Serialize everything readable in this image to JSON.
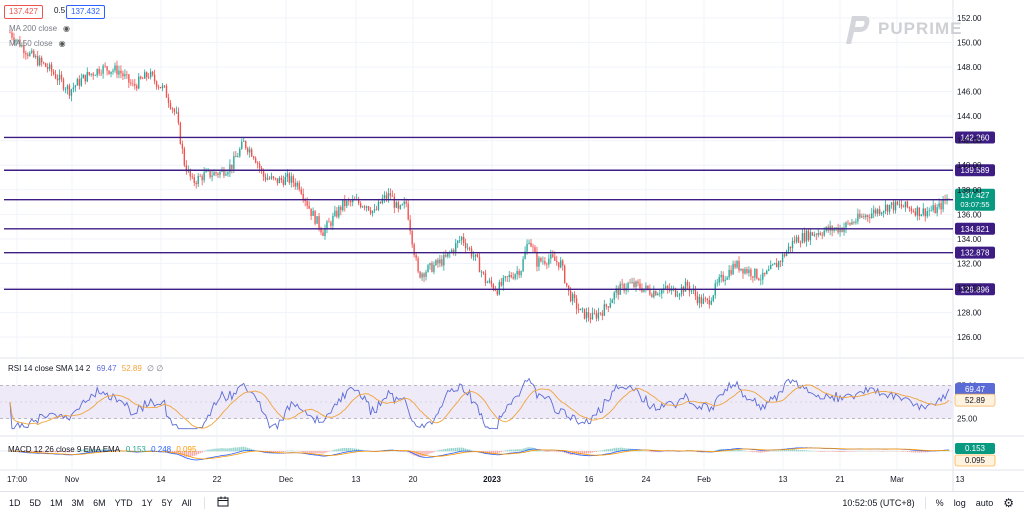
{
  "header": {
    "bid": "137.427",
    "spread": "0.5",
    "ask": "137.432"
  },
  "legend": {
    "ma200": "MA 200 close",
    "ma50": "MA 50 close",
    "rsi": "RSI 14 close SMA 14 2",
    "rsi_val": "69.47",
    "rsi_sma_val": "52.89",
    "rsi_extra": "∅ ∅",
    "macd": "MACD 12 26 close 9 EMA EMA",
    "macd_val": "0.153",
    "macd_signal": "0.248",
    "macd_hist": "0.095"
  },
  "logo": {
    "text": "PUPRIME"
  },
  "colors": {
    "bull": "#26a69a",
    "bear": "#ef5350",
    "level": "#3d1d84",
    "rsi": "#5b6bd6",
    "rsi_ma": "#f0a33a",
    "macd": "#2962ff",
    "signal": "#ff9800",
    "current": "#089981"
  },
  "chart_data": {
    "type": "candlestick",
    "y_ticks": [
      126,
      128,
      130,
      132,
      134,
      136,
      138,
      140,
      142,
      144,
      146,
      148,
      150,
      152
    ],
    "ylim": [
      124.3,
      152.8
    ],
    "x_ticks": [
      "17:00",
      "Nov",
      "14",
      "22",
      "Dec",
      "13",
      "20",
      "2023",
      "16",
      "24",
      "Feb",
      "13",
      "21",
      "Mar",
      "13"
    ],
    "price_path": [
      [
        0,
        150.8
      ],
      [
        10,
        149.0
      ],
      [
        20,
        147.8
      ],
      [
        30,
        146.1
      ],
      [
        38,
        147.2
      ],
      [
        46,
        147.9
      ],
      [
        55,
        147.7
      ],
      [
        62,
        146.4
      ],
      [
        70,
        147.4
      ],
      [
        78,
        146.1
      ],
      [
        84,
        144.0
      ],
      [
        88,
        140.2
      ],
      [
        92,
        138.6
      ],
      [
        98,
        139.2
      ],
      [
        106,
        139.4
      ],
      [
        112,
        140.0
      ],
      [
        118,
        141.8
      ],
      [
        123,
        140.9
      ],
      [
        128,
        139.1
      ],
      [
        134,
        138.7
      ],
      [
        140,
        138.9
      ],
      [
        146,
        138.4
      ],
      [
        152,
        136.2
      ],
      [
        158,
        134.6
      ],
      [
        162,
        135.4
      ],
      [
        168,
        136.8
      ],
      [
        174,
        137.0
      ],
      [
        180,
        136.8
      ],
      [
        184,
        136.1
      ],
      [
        188,
        137.2
      ],
      [
        192,
        137.6
      ],
      [
        196,
        136.2
      ],
      [
        200,
        136.9
      ],
      [
        206,
        131.1
      ],
      [
        212,
        131.6
      ],
      [
        220,
        132.4
      ],
      [
        228,
        134.1
      ],
      [
        236,
        132.1
      ],
      [
        240,
        130.6
      ],
      [
        246,
        129.9
      ],
      [
        252,
        130.9
      ],
      [
        258,
        131.6
      ],
      [
        262,
        134.1
      ],
      [
        266,
        132.1
      ],
      [
        272,
        132.4
      ],
      [
        278,
        132.0
      ],
      [
        282,
        129.6
      ],
      [
        288,
        128.0
      ],
      [
        294,
        127.6
      ],
      [
        300,
        128.3
      ],
      [
        306,
        129.7
      ],
      [
        312,
        130.3
      ],
      [
        318,
        130.1
      ],
      [
        324,
        129.7
      ],
      [
        330,
        129.9
      ],
      [
        336,
        129.7
      ],
      [
        342,
        130.2
      ],
      [
        348,
        129.0
      ],
      [
        352,
        128.8
      ],
      [
        358,
        130.5
      ],
      [
        366,
        131.9
      ],
      [
        374,
        131.3
      ],
      [
        380,
        130.8
      ],
      [
        388,
        132.1
      ],
      [
        396,
        133.9
      ],
      [
        404,
        134.4
      ],
      [
        412,
        134.7
      ],
      [
        420,
        134.9
      ],
      [
        428,
        135.6
      ],
      [
        436,
        136.2
      ],
      [
        444,
        136.7
      ],
      [
        452,
        136.6
      ],
      [
        460,
        136.2
      ],
      [
        468,
        136.4
      ],
      [
        474,
        137.43
      ]
    ],
    "horizontal_levels": [
      142.26,
      139.589,
      137.19,
      134.821,
      132.878,
      129.896
    ],
    "horizontal_level_labels": [
      "142.260",
      "139.589",
      "137.190",
      "134.821",
      "132.878",
      "129.896"
    ],
    "current_price": 137.427,
    "current_price_label": "137.427",
    "countdown": "03:07:55",
    "rsi": {
      "ticks": [
        "75.00",
        "25.00"
      ],
      "upper": 75,
      "lower": 25,
      "last": 69.47,
      "last_ma": 52.89
    },
    "macd": {
      "last": 0.153,
      "last_signal": 0.248,
      "last_hist": 0.095
    }
  },
  "toolbar": {
    "timeframes": [
      "1D",
      "5D",
      "1M",
      "3M",
      "6M",
      "YTD",
      "1Y",
      "5Y",
      "All"
    ],
    "time": "10:52:05 (UTC+8)",
    "percent": "%",
    "log": "log",
    "auto": "auto"
  }
}
